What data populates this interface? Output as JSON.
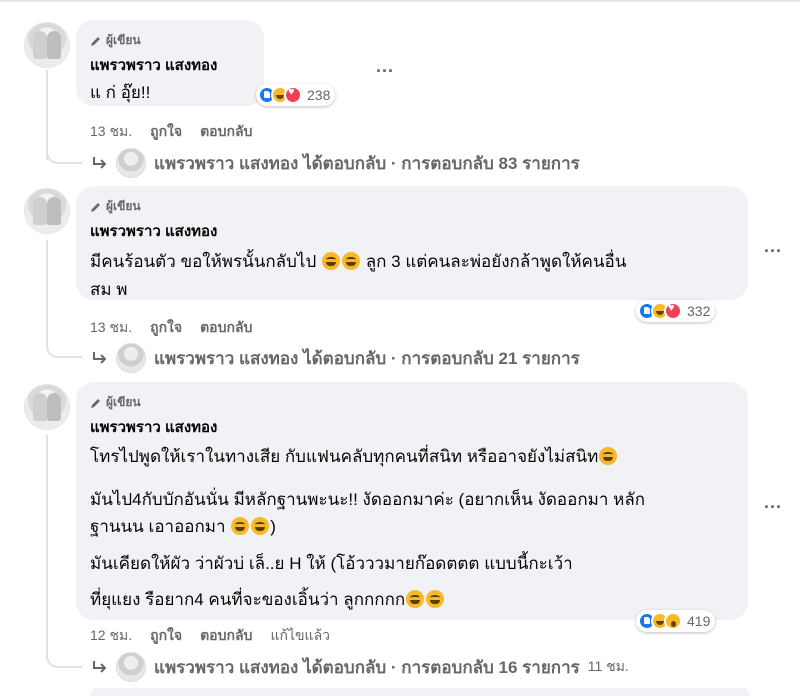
{
  "comments": [
    {
      "badge": "ผู้เขียน",
      "author": "แพรวพราว แสงทอง",
      "lines": [
        "แ ก่ อุ๊ย!!"
      ],
      "reaction_count": "238",
      "time": "13 ชม.",
      "like_label": "ถูกใจ",
      "reply_label": "ตอบกลับ",
      "reply_summary": "แพรวพราว แสงทอง ได้ตอบกลับ · การตอบกลับ 83 รายการ"
    },
    {
      "badge": "ผู้เขียน",
      "author": "แพรวพราว แสงทอง",
      "lines": [
        "มีคนร้อนตัว ขอให้พรนั้นกลับไป",
        "ลูก 3 แต่คนละพ่อยังกล้าพูดให้คนอื่น",
        "สม พ"
      ],
      "reaction_count": "332",
      "time": "13 ชม.",
      "like_label": "ถูกใจ",
      "reply_label": "ตอบกลับ",
      "reply_summary": "แพรวพราว แสงทอง ได้ตอบกลับ · การตอบกลับ 21 รายการ"
    },
    {
      "badge": "ผู้เขียน",
      "author": "แพรวพราว แสงทอง",
      "lines": [
        "โทรไปพูดให้เราในทางเสีย กับแฟนคลับทุกคนที่สนิท หรืออาจยังไม่สนิท",
        "มันไป4กับบักอันนั่น มีหลักฐานพะนะ!! งัดออกมาค่ะ (อยากเห็น งัดออกมา หลัก",
        "ฐานนน เอาออกมา",
        ")",
        "มันเคียดให้ผัว ว่าผัวบ่ เล็..ย H ให้ (โอ้วววมายก๊อดตตต แบบนี้กะเว้า",
        "ที่ยุแยง รือยาก4 คนที่จะของเอิ้นว่า ลูกกกกก"
      ],
      "reaction_count": "419",
      "time": "12 ชม.",
      "like_label": "ถูกใจ",
      "reply_label": "ตอบกลับ",
      "edited_label": "แก้ไขแล้ว",
      "reply_summary": "แพรวพราว แสงทอง ได้ตอบกลับ · การตอบกลับ 16 รายการ",
      "reply_time": "11 ชม."
    }
  ],
  "more_label": "...",
  "icons": {
    "author_badge": "pen-icon",
    "reply": "reply-arrow-icon",
    "more": "more-options-icon"
  },
  "colors": {
    "bubble": "#f0f2f5",
    "secondary_text": "#65676b",
    "like_blue": "#1877f2",
    "love_red": "#f33e58",
    "haha_yellow": "#f7b928"
  }
}
